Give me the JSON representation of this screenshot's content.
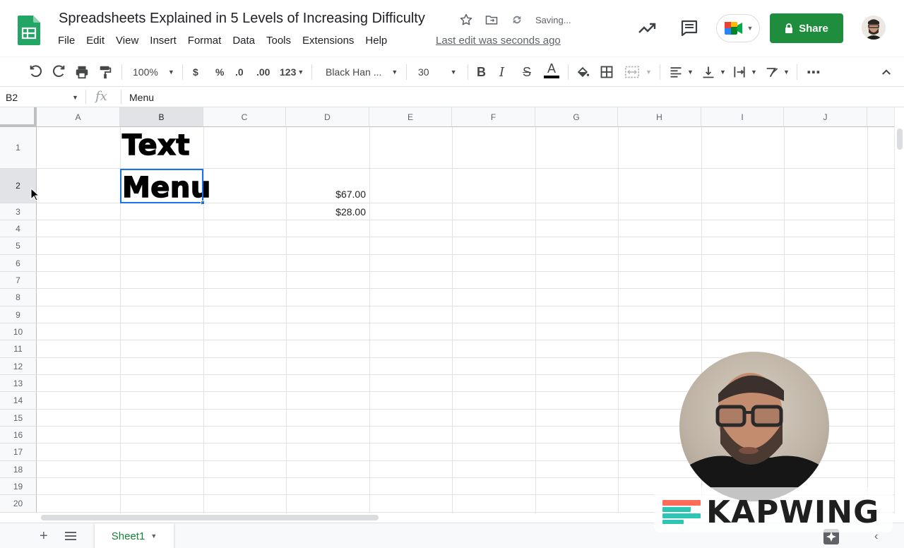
{
  "header": {
    "title": "Spreadsheets Explained in 5 Levels of Increasing Difficulty",
    "saving_status": "Saving...",
    "last_edit": "Last edit was seconds ago",
    "share_label": "Share",
    "menu": [
      "File",
      "Edit",
      "View",
      "Insert",
      "Format",
      "Data",
      "Tools",
      "Extensions",
      "Help"
    ]
  },
  "toolbar": {
    "zoom": "100%",
    "currency": "$",
    "percent": "%",
    "decrease_decimals": ".0",
    "increase_decimals": ".00",
    "more_formats": "123",
    "font_family": "Black Han ...",
    "font_size": "30",
    "bold": "B",
    "italic": "I",
    "strike": "S",
    "text_color": "A",
    "more": "⋯"
  },
  "formula_bar": {
    "cell_ref": "B2",
    "fx": "fx",
    "value": "Menu"
  },
  "grid": {
    "columns": [
      "A",
      "B",
      "C",
      "D",
      "E",
      "F",
      "G",
      "H",
      "I",
      "J"
    ],
    "rows": [
      "1",
      "2",
      "3",
      "4",
      "5",
      "6",
      "7",
      "8",
      "9",
      "10",
      "11",
      "12",
      "13",
      "14",
      "15",
      "16",
      "17",
      "18",
      "19",
      "20"
    ],
    "selected_col": "B",
    "selected_row": "2",
    "cells": {
      "B1": "Text",
      "B2": "Menu",
      "D2": "$67.00",
      "D3": "$28.00"
    }
  },
  "sheets": {
    "add": "+",
    "tabs": [
      "Sheet1"
    ]
  },
  "watermark": {
    "text": "KAPWING"
  },
  "colors": {
    "share_green": "#1e8e3e",
    "sheet_tab_green": "#188038",
    "selection_blue": "#1a73e8"
  }
}
